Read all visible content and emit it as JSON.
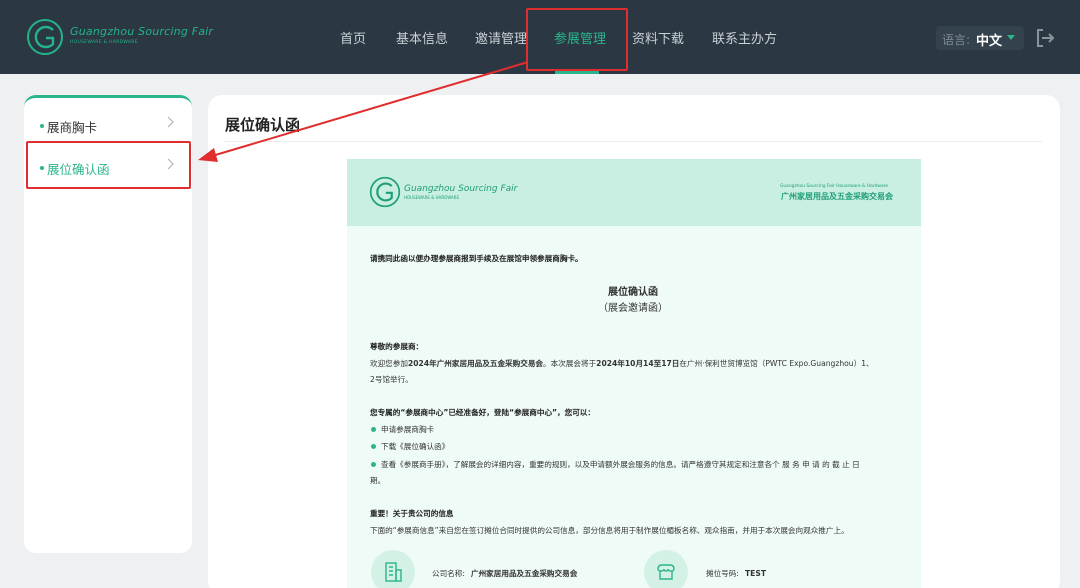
{
  "header": {
    "logo": {
      "main": "Guangzhou Sourcing Fair",
      "sub": "HOUSEWARE & HARDWARE"
    },
    "nav": [
      {
        "label": "首页"
      },
      {
        "label": "基本信息"
      },
      {
        "label": "邀请管理"
      },
      {
        "label": "参展管理",
        "active": true
      },
      {
        "label": "资料下载"
      },
      {
        "label": "联系主办方"
      }
    ],
    "language": {
      "label": "语言:",
      "value": "中文"
    }
  },
  "sidebar": {
    "items": [
      {
        "label": "展商胸卡"
      },
      {
        "label": "展位确认函",
        "active": true
      }
    ]
  },
  "main": {
    "title": "展位确认函",
    "letter": {
      "header": {
        "logo_main": "Guangzhou Sourcing Fair",
        "logo_sub": "HOUSEWARE & HARDWARE",
        "right_en": "Guangzhou Sourcing Fair Houseware & Hardware",
        "right_cn": "广州家居用品及五金采购交易会"
      },
      "notice": "请携同此函以便办理参展商报到手续及在展馆申领参展商胸卡。",
      "title": "展位确认函",
      "subtitle": "（展会邀请函）",
      "greeting": "尊敬的参展商：",
      "intro_1": "欢迎您参加",
      "intro_fair": "2024年广州家居用品及五金采购交易会",
      "intro_2": "。本次展会将于",
      "intro_date": "2024年10月14至17日",
      "intro_3": "在广州·保利世贸博览馆（PWTC Expo.Guangzhou）1、",
      "intro_line2": "2号馆举行。",
      "center_heading": "您专属的“参展商中心”已经准备好，登陆“参展商中心”，您可以：",
      "bullets": [
        "申请参展商胸卡",
        "下载《展位确认函》",
        "查看《参展商手册》，了解展会的详细内容，重要的规则，以及申请额外展会服务的信息。请严格遵守其规定和注意各个 服 务 申 请 的 截 止 日"
      ],
      "bullet3_line2": "期。",
      "important_heading": "重要！关于贵公司的信息",
      "important_text": "下面的“参展商信息”来自您在签订摊位合同时提供的公司信息，部分信息将用于制作展位楣板名称、观众指南，并用于本次展会向观众推广上。",
      "company_label": "公司名称:",
      "company_value": "广州家居用品及五金采购交易会",
      "booth_label": "摊位号码:",
      "booth_value": "TEST"
    }
  },
  "colors": {
    "header_bg": "#2b3743",
    "accent": "#2bb58c",
    "highlight": "#e02d2d",
    "page_bg": "#eef0f2"
  },
  "icons": [
    "logo-c-icon",
    "caret-down-icon",
    "logout-icon",
    "chevron-right-icon",
    "building-icon",
    "storefront-icon"
  ]
}
